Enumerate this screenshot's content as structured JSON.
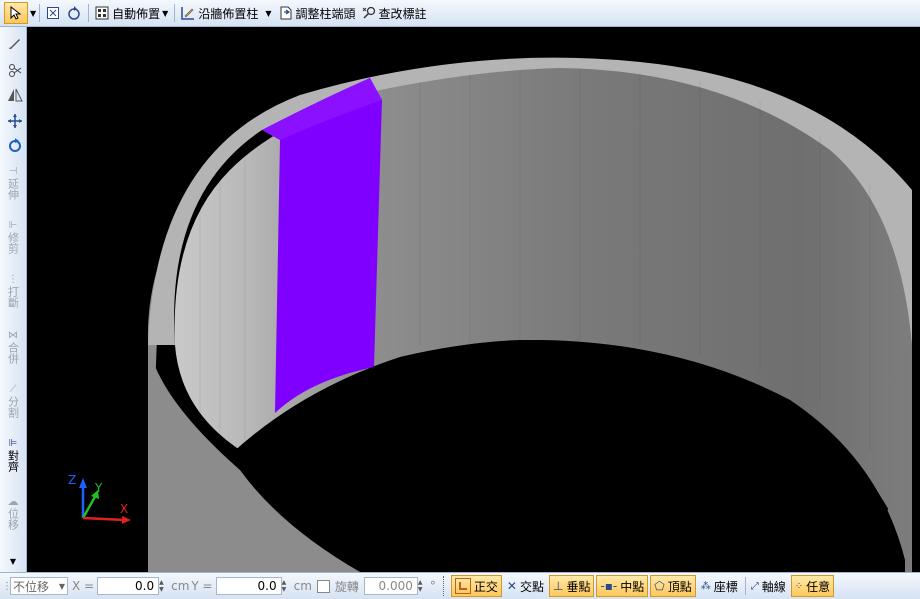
{
  "toolbar": {
    "auto_place_label": "自動佈置",
    "along_wall_label": "沿牆佈置柱",
    "adjust_column_label": "調整柱端頭",
    "modify_label_label": "查改標註"
  },
  "sidebar": {
    "extend_label": "延伸",
    "trim_label": "修剪",
    "break_label": "打斷",
    "merge_label": "合併",
    "split_label": "分割",
    "align_label": "對齊",
    "move_label": "位移"
  },
  "viewport": {
    "axis_x": "X",
    "axis_y": "Y",
    "axis_z": "Z"
  },
  "status": {
    "mode_select": "不位移",
    "x_label": "X =",
    "x_value": "0.0",
    "x_unit": "cm",
    "y_label": "Y =",
    "y_value": "0.0",
    "y_unit": "cm",
    "rotate_label": "旋轉",
    "rotate_value": "0.000",
    "rotate_unit": "°",
    "snaps": [
      {
        "label": "正交",
        "on": true
      },
      {
        "label": "交點",
        "on": false
      },
      {
        "label": "垂點",
        "on": true
      },
      {
        "label": "中點",
        "on": true
      },
      {
        "label": "頂點",
        "on": true
      },
      {
        "label": "座標",
        "on": false
      },
      {
        "label": "軸線",
        "on": false
      },
      {
        "label": "任意",
        "on": true
      }
    ]
  },
  "colors": {
    "accent": "#ffc85a",
    "selected_segment": "#8000ff",
    "wall_outer": "#8c8c8c",
    "wall_top": "#b4b4b4"
  }
}
